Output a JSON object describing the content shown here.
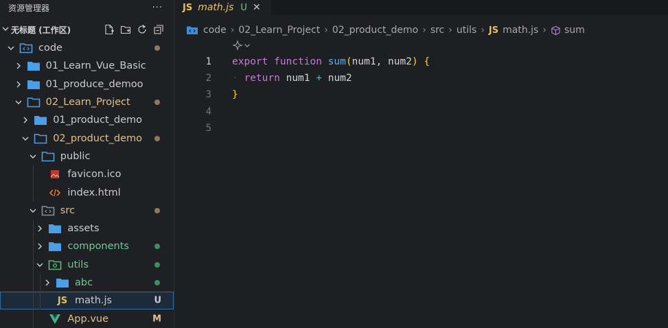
{
  "explorer": {
    "title": "资源管理器",
    "more": "···",
    "workspace": "无标题 (工作区)"
  },
  "tree": [
    {
      "label": "code",
      "type": "folder-code",
      "depth": 0,
      "expanded": true,
      "status": "dot",
      "color": "#cccccc"
    },
    {
      "label": "01_Learn_Vue_Basic",
      "type": "folder",
      "depth": 1,
      "expanded": false,
      "status": "",
      "color": "#cccccc"
    },
    {
      "label": "01_produce_demoo",
      "type": "folder",
      "depth": 1,
      "expanded": false,
      "status": "",
      "color": "#cccccc"
    },
    {
      "label": "02_Learn_Project",
      "type": "folder-open",
      "depth": 1,
      "expanded": true,
      "status": "dot",
      "color": "#e2c08d"
    },
    {
      "label": "01_product_demo",
      "type": "folder",
      "depth": 2,
      "expanded": false,
      "status": "",
      "color": "#cccccc"
    },
    {
      "label": "02_product_demo",
      "type": "folder-open",
      "depth": 2,
      "expanded": true,
      "status": "dot",
      "color": "#e2c08d"
    },
    {
      "label": "public",
      "type": "folder-open",
      "depth": 3,
      "expanded": true,
      "status": "",
      "color": "#cccccc"
    },
    {
      "label": "favicon.ico",
      "type": "file-ico",
      "depth": 4,
      "status": "",
      "color": "#cccccc"
    },
    {
      "label": "index.html",
      "type": "file-html",
      "depth": 4,
      "status": "",
      "color": "#cccccc"
    },
    {
      "label": "src",
      "type": "folder-src",
      "depth": 3,
      "expanded": true,
      "status": "dot",
      "color": "#e2c08d"
    },
    {
      "label": "assets",
      "type": "folder",
      "depth": 4,
      "expanded": false,
      "status": "",
      "color": "#cccccc"
    },
    {
      "label": "components",
      "type": "folder",
      "depth": 4,
      "expanded": false,
      "status": "dot-green",
      "color": "#73c991"
    },
    {
      "label": "utils",
      "type": "folder-utils",
      "depth": 4,
      "expanded": true,
      "status": "dot-green",
      "color": "#73c991"
    },
    {
      "label": "abc",
      "type": "folder",
      "depth": 5,
      "expanded": false,
      "status": "dot-green",
      "color": "#73c991"
    },
    {
      "label": "math.js",
      "type": "file-js",
      "depth": 5,
      "status": "U",
      "color": "#cccccc",
      "selected": true
    },
    {
      "label": "App.vue",
      "type": "file-vue",
      "depth": 4,
      "status": "M",
      "color": "#e2c08d"
    }
  ],
  "tab": {
    "icon": "JS",
    "name": "math.js",
    "status": "U",
    "close": "✕"
  },
  "breadcrumb": {
    "parts": [
      "code",
      "02_Learn_Project",
      "02_product_demo",
      "src",
      "utils"
    ],
    "file_icon": "JS",
    "file": "math.js",
    "symbol": "sum"
  },
  "code": {
    "line_numbers": [
      "1",
      "2",
      "3",
      "4",
      "5"
    ],
    "kw_export": "export",
    "kw_function": "function",
    "fn_name": "sum",
    "paren_open": "(",
    "param1": "num1",
    "comma": ", ",
    "param2": "num2",
    "paren_close": ")",
    "brace_open": "{",
    "kw_return": "return",
    "ret_a": "num1",
    "op_plus": "+",
    "ret_b": "num2",
    "brace_close": "}"
  },
  "colors": {
    "folder": "#4a9fe8",
    "modified": "#e2c08d",
    "untracked": "#73c991",
    "js": "#e8c05c",
    "vue": "#41b883"
  }
}
